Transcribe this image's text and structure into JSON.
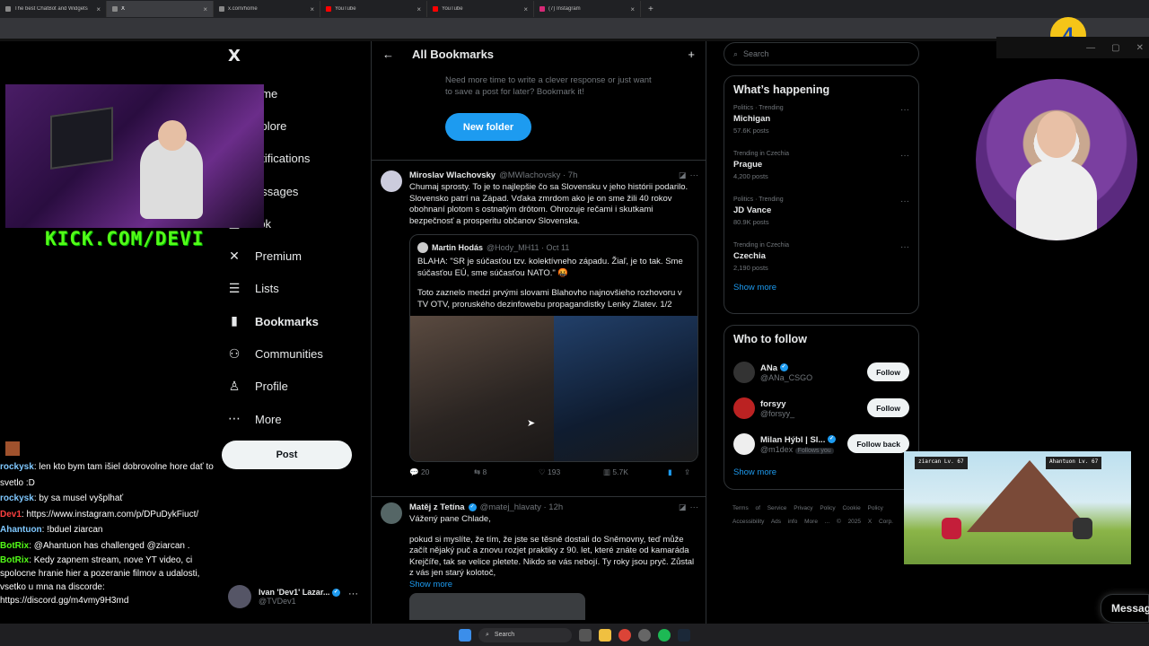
{
  "browser": {
    "tabs": [
      {
        "label": "The best ChatBot and Widgets",
        "icon": "bot-icon"
      },
      {
        "label": "X",
        "icon": "x-icon"
      },
      {
        "label": "x.com/home",
        "icon": "x-icon"
      },
      {
        "label": "YouTube",
        "icon": "youtube-icon"
      },
      {
        "label": "YouTube",
        "icon": "youtube-icon"
      },
      {
        "label": "(7) Instagram",
        "icon": "instagram-icon"
      }
    ],
    "new_tab": "+",
    "close": "×"
  },
  "overlay": {
    "kick_text": "KICK.COM/DEVI",
    "badge": "4"
  },
  "nav": {
    "logo": "X",
    "items": [
      {
        "label": "ome",
        "icon": "home-icon",
        "glyph": "⌂"
      },
      {
        "label": "xplore",
        "icon": "search-icon",
        "glyph": "⌕"
      },
      {
        "label": "otifications",
        "icon": "bell-icon",
        "glyph": "♪"
      },
      {
        "label": "essages",
        "icon": "mail-icon",
        "glyph": "✉"
      },
      {
        "label": "rok",
        "icon": "grok-icon",
        "glyph": "◪"
      },
      {
        "label": "Premium",
        "icon": "x-icon",
        "glyph": "✕"
      },
      {
        "label": "Lists",
        "icon": "list-icon",
        "glyph": "☰"
      },
      {
        "label": "Bookmarks",
        "icon": "bookmark-icon",
        "glyph": "▮"
      },
      {
        "label": "Communities",
        "icon": "people-icon",
        "glyph": "⚇"
      },
      {
        "label": "Profile",
        "icon": "person-icon",
        "glyph": "♙"
      },
      {
        "label": "More",
        "icon": "more-circle-icon",
        "glyph": "⋯"
      }
    ],
    "post_button": "Post",
    "account": {
      "name": "Ivan 'Dev1' Lazar...",
      "handle": "@TVDev1",
      "more": "···"
    }
  },
  "main": {
    "back": "←",
    "title": "All Bookmarks",
    "add_folder_icon": "+",
    "intro": "Need more time to write a clever response or just want to save a post for later? Bookmark it!",
    "new_folder": "New folder",
    "tweets": [
      {
        "name": "Miroslav Wlachovsky",
        "handle": "@MWlachovsky · 7h",
        "text": "Chumaj sprosty. To je to najlepšie čo sa Slovensku v jeho histórii podarilo. Slovensko patrí na Západ. Vďaka zmrdom ako je on sme žili 40 rokov obohnaní plotom s ostnatým drôtom. Ohrozuje rečami i skutkami bezpečnosť a prosperitu občanov Slovenska.",
        "quote": {
          "name": "Martin Hodás",
          "handle": "@Hody_MH11 · Oct 11",
          "text1": "BLAHA: \"SR je súčasťou tzv. kolektívneho západu. Žiaľ, je to tak. Sme súčasťou EÚ, sme súčasťou NATO.\" 🤬",
          "text2": "Toto zaznelo medzi prvými slovami Blahovho najnovšieho rozhovoru v TV OTV, proruského dezinfowebu propagandistky Lenky Zlatev. 1/2"
        },
        "actions": {
          "replies": "20",
          "reposts": "8",
          "likes": "193",
          "views": "5.7K"
        }
      },
      {
        "name": "Matěj z Tetína",
        "handle": "@matej_hlavaty · 12h",
        "text1": "Vážený pane Chlade,",
        "text2": "pokud si myslíte, že tím, že jste se těsně dostali do Sněmovny, teď může začít nějaký puč a znovu rozjet praktiky z 90. let, které znáte od kamaráda Krejčíře, tak se velice pletete. Nikdo se vás nebojí. Ty roky jsou pryč. Zůstal z vás jen starý kolotoč,",
        "show_more": "Show more"
      }
    ]
  },
  "right": {
    "search_placeholder": "Search",
    "happening_title": "What’s happening",
    "trends": [
      {
        "context": "Politics · Trending",
        "title": "Michigan",
        "count": "57.6K posts"
      },
      {
        "context": "Trending in Czechia",
        "title": "Prague",
        "count": "4,200 posts"
      },
      {
        "context": "Politics · Trending",
        "title": "JD Vance",
        "count": "80.9K posts"
      },
      {
        "context": "Trending in Czechia",
        "title": "Czechia",
        "count": "2,190 posts"
      }
    ],
    "show_more": "Show more",
    "follow_title": "Who to follow",
    "follow": [
      {
        "name": "ANa",
        "handle": "@ANa_CSGO",
        "button": "Follow",
        "verified": true
      },
      {
        "name": "forsyy",
        "handle": "@forsyy_",
        "button": "Follow",
        "verified": false
      },
      {
        "name": "Milan Hýbl | Sl...",
        "handle": "@m1dex",
        "extra": "Follows you",
        "button": "Follow back",
        "verified": true
      }
    ],
    "footer": "Terms of Service Privacy Policy Cookie Policy Accessibility Ads info More ... © 2025 X Corp.",
    "messages": "Messag"
  },
  "chat": [
    {
      "user": "rockysk",
      "msg": ": len kto bym tam išiel dobrovolne hore dať to svetlo :D",
      "color": "#7fc8ff"
    },
    {
      "user": "rockysk",
      "msg": ": by sa musel vyšplhať",
      "color": "#7fc8ff"
    },
    {
      "user": "Dev1",
      "msg": ": https://www.instagram.com/p/DPuDykFiuct/",
      "color": "#ff4040"
    },
    {
      "user": "Ahantuon",
      "msg": ": !bduel ziarcan",
      "color": "#7fc8ff"
    },
    {
      "user": "BotRix",
      "msg": ": @Ahantuon has challenged @ziarcan .",
      "color": "#53fc18"
    },
    {
      "user": "BotRix",
      "msg": ": Kedy zapnem stream, nove YT video, ci spolocne hranie hier a pozeranie filmov a udalosti, vsetko u mna na discorde: https://discord.gg/m4vmy9H3md",
      "color": "#53fc18"
    }
  ],
  "game": {
    "p1": "ziarcan",
    "p1lv": "Lv. 67",
    "p2": "Ahantuon",
    "p2lv": "Lv. 67"
  },
  "taskbar": {
    "search": "Search"
  }
}
